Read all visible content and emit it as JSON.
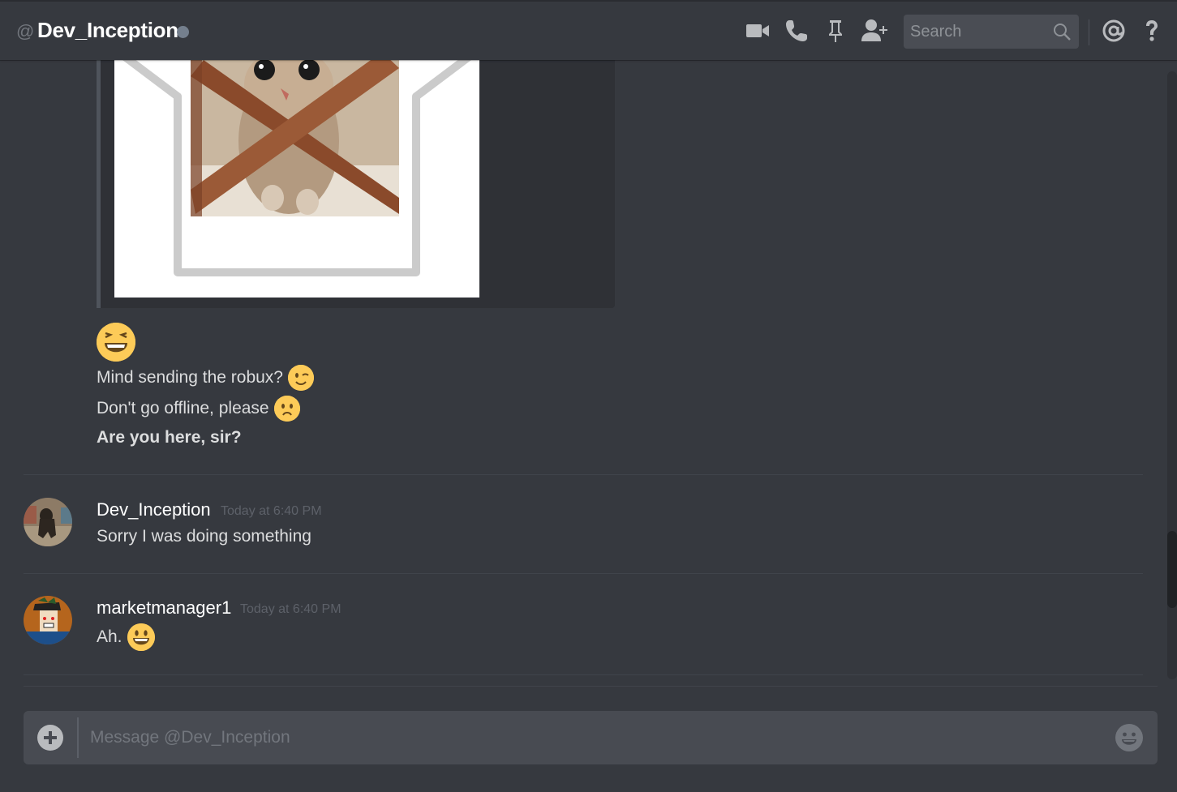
{
  "header": {
    "at_symbol": "@",
    "title": "Dev_Inception",
    "status": "offline",
    "status_color": "#747f8d",
    "icons": [
      "video-call-icon",
      "voice-call-icon",
      "pinned-messages-icon",
      "add-friend-icon"
    ],
    "search_placeholder": "Search",
    "mentions_icon": "at-icon",
    "help_icon": "help-icon"
  },
  "messages": {
    "embed": {
      "description": "kitten behind crossed wooden chair legs in a tray frame"
    },
    "continued_lines": [
      {
        "text": "",
        "emoji": "grinning-squinting-face",
        "large": true
      },
      {
        "text": "Mind sending the robux?",
        "emoji": "winking-face"
      },
      {
        "text": "Don't go offline, please",
        "emoji": "frowning-face"
      },
      {
        "text": "Are you here, sir?",
        "bold": true
      }
    ],
    "groups": [
      {
        "username": "Dev_Inception",
        "timestamp": "Today at 6:40 PM",
        "avatar": "chimpanzee-photo-avatar",
        "lines": [
          {
            "text": "Sorry I was doing something"
          }
        ]
      },
      {
        "username": "marketmanager1",
        "timestamp": "Today at 6:40 PM",
        "avatar": "roblox-character-avatar",
        "lines": [
          {
            "text": "Ah.",
            "emoji": "grinning-face-big-eyes"
          }
        ]
      }
    ]
  },
  "composer": {
    "placeholder": "Message @Dev_Inception",
    "upload_icon": "plus-circle-icon",
    "emoji_icon": "emoji-picker-icon"
  },
  "colors": {
    "background": "#36393f",
    "text": "#dcddde",
    "username": "#ffffff",
    "timestamp": "#5d6169",
    "emoji_yellow": "#fdcb58"
  }
}
